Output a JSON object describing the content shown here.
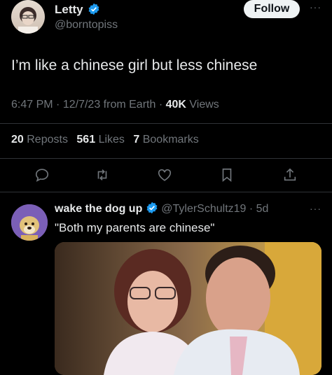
{
  "tweet": {
    "author_name": "Letty",
    "author_handle": "@borntopiss",
    "follow_label": "Follow",
    "more_label": "···",
    "text": "I’m like a chinese girl but less chinese",
    "time": "6:47 PM",
    "date": "12/7/23",
    "source": "from Earth",
    "views_count": "40K",
    "views_label": "Views",
    "reposts_count": "20",
    "reposts_label": "Reposts",
    "likes_count": "561",
    "likes_label": "Likes",
    "bookmarks_count": "7",
    "bookmarks_label": "Bookmarks"
  },
  "reply": {
    "author_name": "wake the dog up",
    "author_handle": "@TylerSchultz19",
    "age": "5d",
    "more_label": "···",
    "text": "\"Both my parents are chinese\""
  },
  "colors": {
    "background": "#000000",
    "text": "#e7e9ea",
    "muted": "#71767b",
    "verified": "#1d9bf0",
    "divider": "#2f3336"
  },
  "icons": [
    "verified-badge-icon",
    "reply-icon",
    "repost-icon",
    "like-icon",
    "bookmark-icon",
    "share-icon"
  ]
}
